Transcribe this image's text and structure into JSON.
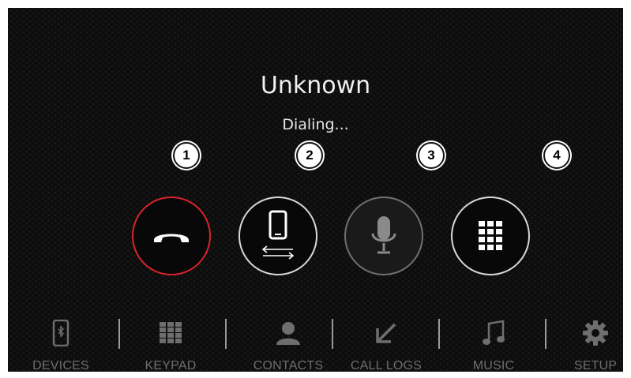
{
  "call": {
    "caller_name": "Unknown",
    "status": "Dialing..."
  },
  "markers": [
    "1",
    "2",
    "3",
    "4"
  ],
  "controls": [
    {
      "name": "end-call-button",
      "icon": "hang-up-icon",
      "color": "#d8242b"
    },
    {
      "name": "transfer-to-phone-button",
      "icon": "phone-transfer-icon"
    },
    {
      "name": "mute-mic-button",
      "icon": "microphone-icon",
      "state": "disabled"
    },
    {
      "name": "keypad-button",
      "icon": "keypad-grid-icon"
    }
  ],
  "nav": {
    "items": [
      {
        "label": "DEVICES",
        "icon": "bluetooth-phone-icon"
      },
      {
        "label": "KEYPAD",
        "icon": "keypad-grid-icon"
      },
      {
        "label": "CONTACTS",
        "icon": "person-icon"
      },
      {
        "label": "CALL LOGS",
        "icon": "call-log-arrow-icon"
      },
      {
        "label": "MUSIC",
        "icon": "music-note-icon"
      },
      {
        "label": "SETUP",
        "icon": "gear-icon"
      }
    ]
  },
  "colors": {
    "background": "#0d0d0d",
    "end_call": "#d8242b",
    "nav_inactive": "#6e6e6e"
  }
}
